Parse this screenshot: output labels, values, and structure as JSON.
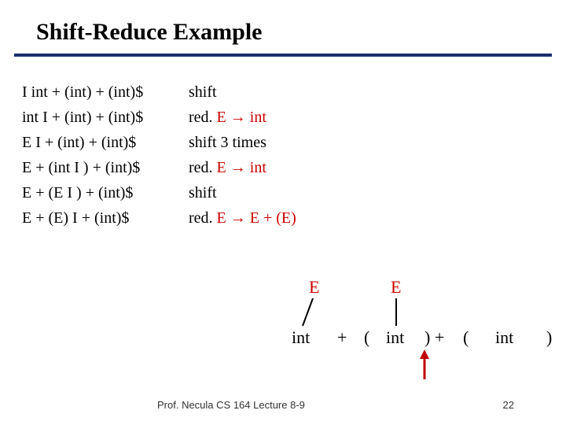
{
  "title": "Shift-Reduce Example",
  "steps": [
    {
      "lhs": "I int + (int) + (int)$",
      "rhs_prefix": "shift",
      "rhs_suffix": ""
    },
    {
      "lhs": "int I + (int) + (int)$",
      "rhs_prefix": "red. ",
      "rhs_red": "E → int",
      "rhs_suffix": ""
    },
    {
      "lhs": "E I + (int) + (int)$",
      "rhs_prefix": "shift 3 times",
      "rhs_suffix": ""
    },
    {
      "lhs": "E + (int I ) + (int)$",
      "rhs_prefix": "red. ",
      "rhs_red": "E → int",
      "rhs_suffix": ""
    },
    {
      "lhs": "E + (E I ) + (int)$",
      "rhs_prefix": "shift",
      "rhs_suffix": ""
    },
    {
      "lhs": "E + (E) I + (int)$",
      "rhs_prefix": "red. ",
      "rhs_red": "E → E + (E)",
      "rhs_suffix": ""
    }
  ],
  "tree": {
    "E1": "E",
    "E2": "E",
    "t1": "int",
    "t2": "+",
    "t3": "(",
    "t4": "int",
    "t5": ") +",
    "t6": "(",
    "t7": "int",
    "t8": ")"
  },
  "arrow_color": "#c00000",
  "footer_left": "Prof. Necula  CS 164  Lecture 8-9",
  "footer_right": "22"
}
